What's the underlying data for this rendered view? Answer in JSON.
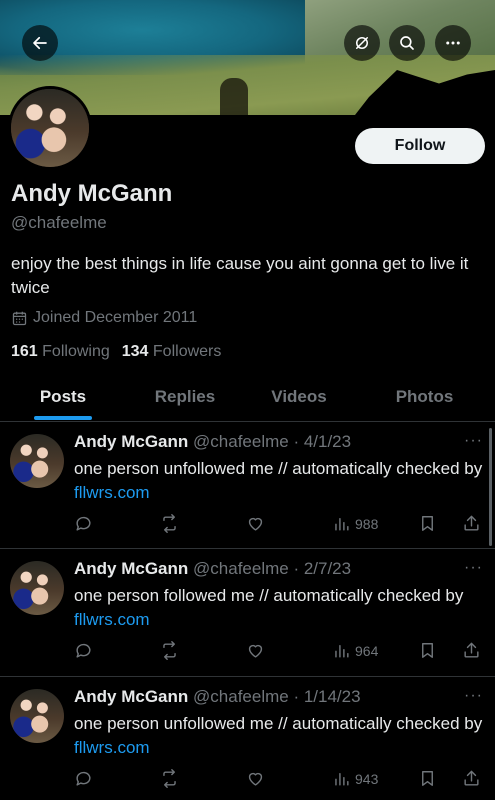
{
  "header": {
    "back_icon": "arrow-left-icon",
    "top_icons": [
      "notifications-off-icon",
      "search-icon",
      "more-icon"
    ]
  },
  "profile": {
    "follow_label": "Follow",
    "name": "Andy McGann",
    "handle": "@chafeelme",
    "bio": "enjoy the best things in life cause you aint gonna get to live it twice",
    "joined": "Joined December 2011",
    "following_count": "161",
    "following_label": "Following",
    "followers_count": "134",
    "followers_label": "Followers"
  },
  "tabs": [
    {
      "label": "Posts",
      "active": true
    },
    {
      "label": "Replies",
      "active": false
    },
    {
      "label": "Videos",
      "active": false
    },
    {
      "label": "Photos",
      "active": false
    }
  ],
  "tweets": [
    {
      "name": "Andy McGann",
      "meta": "@chafeelme · 4/1/23",
      "text_prefix": "one person unfollowed me // automatically checked by ",
      "link": "fllwrs.com",
      "views": "988"
    },
    {
      "name": "Andy McGann",
      "meta": "@chafeelme · 2/7/23",
      "text_prefix": "one person followed me // automatically checked by ",
      "link": "fllwrs.com",
      "views": "964"
    },
    {
      "name": "Andy McGann",
      "meta": "@chafeelme · 1/14/23",
      "text_prefix": "one person unfollowed me // automatically checked by ",
      "link": "fllwrs.com",
      "views": "943"
    }
  ],
  "colors": {
    "accent": "#1d9bf0",
    "text_primary": "#e7e9ea",
    "text_secondary": "#71767b",
    "background": "#000000"
  }
}
